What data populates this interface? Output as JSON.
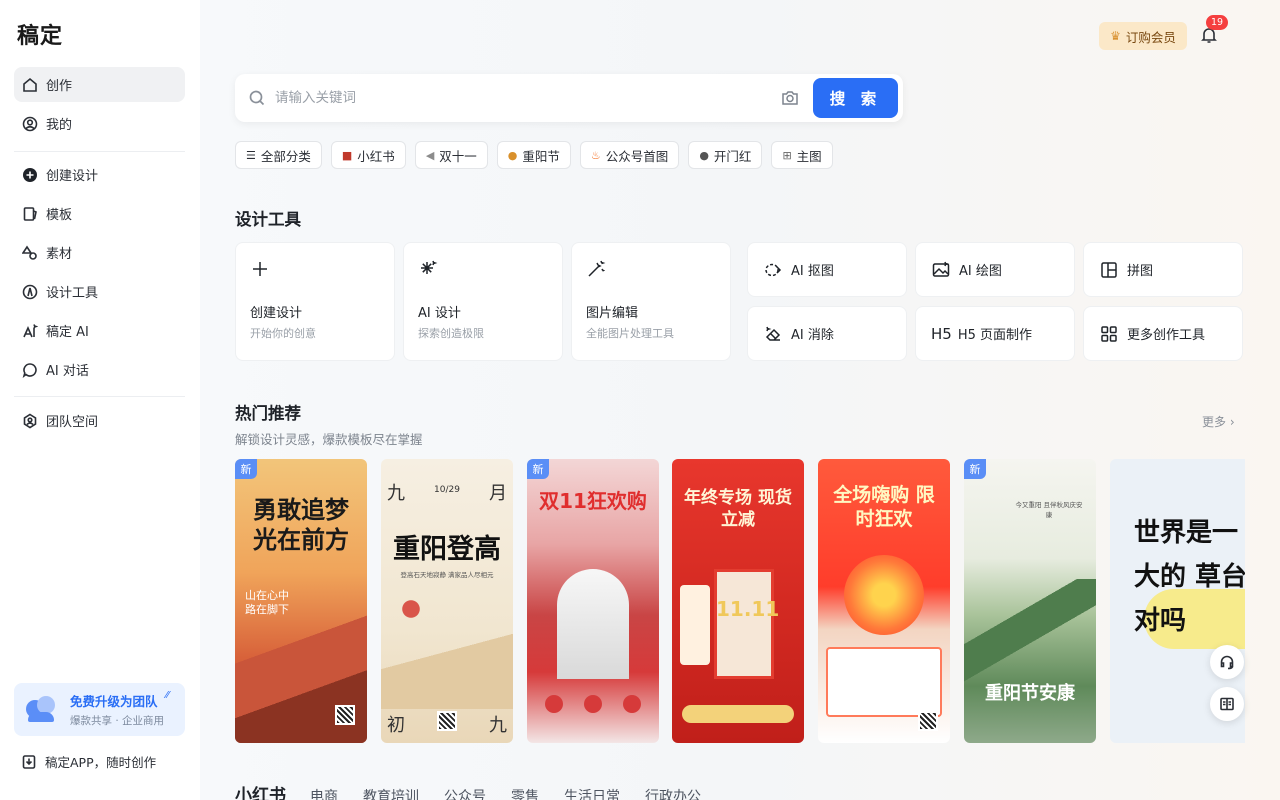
{
  "app": {
    "logo": "稿定"
  },
  "sidebar": {
    "items": [
      {
        "label": "创作"
      },
      {
        "label": "我的"
      },
      {
        "label": "创建设计"
      },
      {
        "label": "模板"
      },
      {
        "label": "素材"
      },
      {
        "label": "设计工具"
      },
      {
        "label": "稿定 AI"
      },
      {
        "label": "AI 对话"
      },
      {
        "label": "团队空间"
      }
    ],
    "upgrade": {
      "title": "免费升级为团队",
      "subtitle": "爆款共享 · 企业商用"
    },
    "app_link": "稿定APP，随时创作"
  },
  "header": {
    "vip_label": "订购会员",
    "notification_count": "19"
  },
  "search": {
    "placeholder": "请输入关键词",
    "button": "搜 索"
  },
  "chips": [
    {
      "label": "全部分类",
      "icon": "menu-icon"
    },
    {
      "label": "小红书",
      "icon": "book-icon"
    },
    {
      "label": "双十一",
      "icon": "megaphone-icon"
    },
    {
      "label": "重阳节",
      "icon": "cookie-icon"
    },
    {
      "label": "公众号首图",
      "icon": "fire-icon"
    },
    {
      "label": "开门红",
      "icon": "ball-icon"
    },
    {
      "label": "主图",
      "icon": "cart-icon"
    }
  ],
  "tools": {
    "title": "设计工具",
    "big": [
      {
        "title": "创建设计",
        "subtitle": "开始你的创意"
      },
      {
        "title": "AI 设计",
        "subtitle": "探索创造极限"
      },
      {
        "title": "图片编辑",
        "subtitle": "全能图片处理工具"
      }
    ],
    "small": [
      {
        "label": "AI 抠图"
      },
      {
        "label": "AI 绘图"
      },
      {
        "label": "拼图"
      },
      {
        "label": "AI 消除"
      },
      {
        "label": "H5 页面制作"
      },
      {
        "label": "更多创作工具"
      }
    ]
  },
  "hot": {
    "title": "热门推荐",
    "subtitle": "解锁设计灵感，爆款模板尽在掌握",
    "more": "更多 ›",
    "new_badge": "新",
    "cards": [
      {
        "title": "勇敢追梦 光在前方"
      },
      {
        "title": "重阳登高"
      },
      {
        "title": "双11狂欢购"
      },
      {
        "title": "年终专场 现货立减"
      },
      {
        "title": "全场嗨购 限时狂欢"
      },
      {
        "title": "重阳节安康"
      },
      {
        "title": "世界是一 巨大的 草台班 对吗"
      }
    ],
    "card_small": {
      "c1_a": "山在心中",
      "c1_b": "路在脚下",
      "c2_left": "九",
      "c2_right": "月",
      "c2_date": "10/29",
      "c2_sub": "登高石天地寂静 满家品人尽相元",
      "c2_bl": "初",
      "c2_br": "九",
      "c4_big": "11.11",
      "c6_line": "今又重阳 且伴秋风庆安康"
    }
  },
  "bottom_tabs": [
    "小红书",
    "电商",
    "教育培训",
    "公众号",
    "零售",
    "生活日常",
    "行政办公"
  ]
}
